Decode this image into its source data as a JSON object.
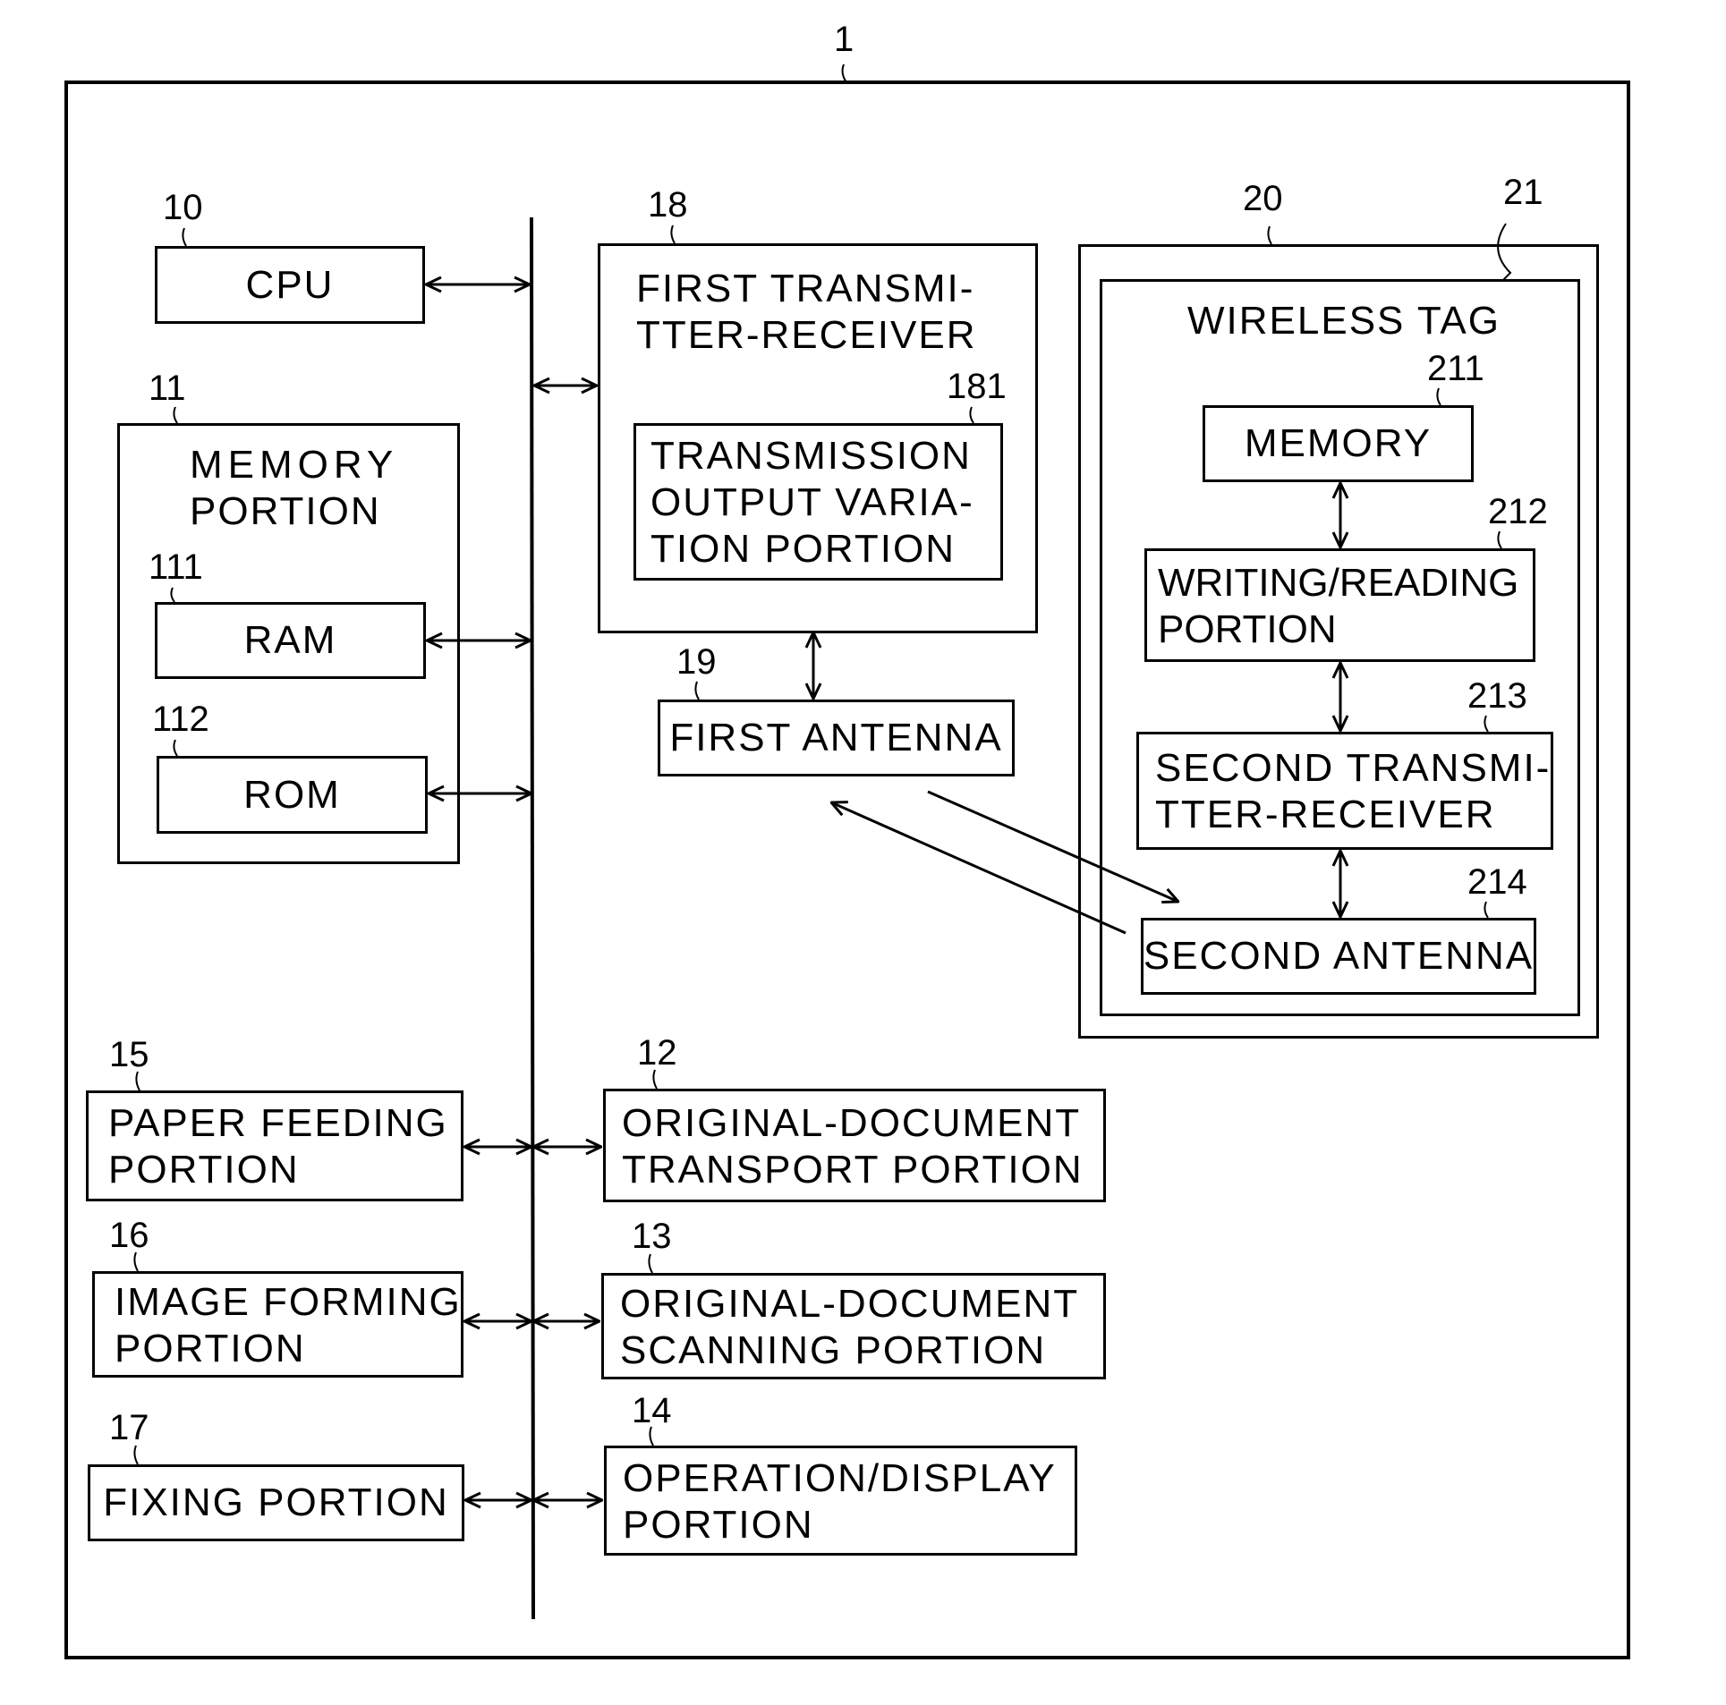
{
  "figure": {
    "ref": "1",
    "bus_label": "system bus"
  },
  "blocks": {
    "cpu": {
      "ref": "10",
      "label": "CPU"
    },
    "memory_portion": {
      "ref": "11",
      "label": [
        "MEMORY",
        "PORTION"
      ]
    },
    "ram": {
      "ref": "111",
      "label": "RAM"
    },
    "rom": {
      "ref": "112",
      "label": "ROM"
    },
    "first_transmitter_receiver": {
      "ref": "18",
      "label": [
        "FIRST TRANSMI-",
        "TTER-RECEIVER"
      ]
    },
    "transmission_output_variation": {
      "ref": "181",
      "label": [
        "TRANSMISSION",
        "OUTPUT VARIA-",
        "TION PORTION"
      ]
    },
    "first_antenna": {
      "ref": "19",
      "label": "FIRST ANTENNA"
    },
    "tag_enclosure": {
      "ref": "20"
    },
    "wireless_tag": {
      "ref": "21",
      "label": "WIRELESS TAG"
    },
    "tag_memory": {
      "ref": "211",
      "label": "MEMORY"
    },
    "writing_reading": {
      "ref": "212",
      "label": [
        "WRITING/READING",
        "PORTION"
      ]
    },
    "second_transmitter_receiver": {
      "ref": "213",
      "label": [
        "SECOND TRANSMI-",
        "TTER-RECEIVER"
      ]
    },
    "second_antenna": {
      "ref": "214",
      "label": "SECOND ANTENNA"
    },
    "paper_feeding": {
      "ref": "15",
      "label": [
        "PAPER FEEDING",
        "PORTION"
      ]
    },
    "image_forming": {
      "ref": "16",
      "label": [
        "IMAGE FORMING",
        "PORTION"
      ]
    },
    "fixing": {
      "ref": "17",
      "label": "FIXING PORTION"
    },
    "doc_transport": {
      "ref": "12",
      "label": [
        "ORIGINAL-DOCUMENT",
        "TRANSPORT PORTION"
      ]
    },
    "doc_scanning": {
      "ref": "13",
      "label": [
        "ORIGINAL-DOCUMENT",
        "SCANNING PORTION"
      ]
    },
    "operation_display": {
      "ref": "14",
      "label": [
        "OPERATION/DISPLAY",
        "PORTION"
      ]
    }
  },
  "connections": [
    {
      "from": "CPU",
      "to": "bus",
      "type": "bidirectional"
    },
    {
      "from": "RAM",
      "to": "bus",
      "type": "bidirectional"
    },
    {
      "from": "ROM",
      "to": "bus",
      "type": "bidirectional"
    },
    {
      "from": "bus",
      "to": "FIRST TRANSMITTER-RECEIVER",
      "type": "bidirectional"
    },
    {
      "from": "FIRST TRANSMITTER-RECEIVER",
      "to": "FIRST ANTENNA",
      "type": "bidirectional"
    },
    {
      "from": "FIRST ANTENNA",
      "to": "SECOND ANTENNA",
      "type": "wireless"
    },
    {
      "from": "SECOND ANTENNA",
      "to": "FIRST ANTENNA",
      "type": "wireless"
    },
    {
      "from": "MEMORY",
      "to": "WRITING/READING PORTION",
      "type": "bidirectional"
    },
    {
      "from": "WRITING/READING PORTION",
      "to": "SECOND TRANSMITTER-RECEIVER",
      "type": "bidirectional"
    },
    {
      "from": "SECOND TRANSMITTER-RECEIVER",
      "to": "SECOND ANTENNA",
      "type": "bidirectional"
    },
    {
      "from": "PAPER FEEDING PORTION",
      "to": "bus",
      "type": "bidirectional"
    },
    {
      "from": "IMAGE FORMING PORTION",
      "to": "bus",
      "type": "bidirectional"
    },
    {
      "from": "FIXING PORTION",
      "to": "bus",
      "type": "bidirectional"
    },
    {
      "from": "bus",
      "to": "ORIGINAL-DOCUMENT TRANSPORT PORTION",
      "type": "bidirectional"
    },
    {
      "from": "bus",
      "to": "ORIGINAL-DOCUMENT SCANNING PORTION",
      "type": "bidirectional"
    },
    {
      "from": "bus",
      "to": "OPERATION/DISPLAY PORTION",
      "type": "bidirectional"
    }
  ]
}
